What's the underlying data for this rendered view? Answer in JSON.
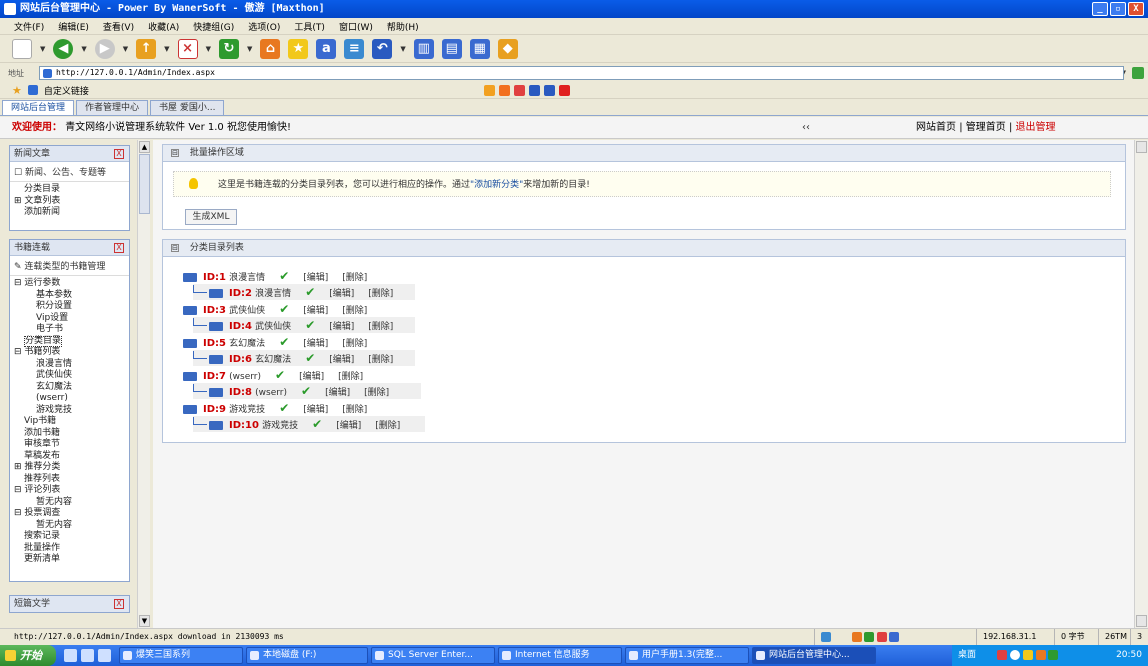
{
  "window": {
    "title": "网站后台管理中心 - Power By WanerSoft - 傲游 [Maxthon]",
    "min": "_",
    "max": "▫",
    "close": "X"
  },
  "menu": [
    "文件(F)",
    "编辑(E)",
    "查看(V)",
    "收藏(A)",
    "快捷组(G)",
    "选项(O)",
    "工具(T)",
    "窗口(W)",
    "帮助(H)"
  ],
  "address": {
    "label": "地址",
    "url": "http://127.0.0.1/Admin/Index.aspx"
  },
  "favbar": {
    "label": "自定义链接"
  },
  "tabs": [
    "网站后台管理",
    "作者管理中心",
    "书屋 爱国小..."
  ],
  "infobar": {
    "welcome": "欢迎使用：",
    "product": "青文网络小说管理系统软件  Ver 1.0   祝您使用愉快!",
    "arrows": "‹‹",
    "link_home": "网站首页",
    "sep": "|",
    "link_admin": "管理首页",
    "link_exit": "退出管理"
  },
  "sidebar": {
    "news": {
      "title": "新闻文章",
      "close": "X",
      "subtitle": "新闻、公告、专题等",
      "items": [
        "分类目录",
        "文章列表",
        "添加新闻"
      ]
    },
    "books": {
      "title": "书籍连载",
      "close": "X",
      "subtitle": "连载类型的书籍管理",
      "items": [
        "运行参数",
        "基本参数",
        "积分设置",
        "Vip设置",
        "电子书",
        "分类目录",
        "书籍列表",
        "浪漫言情",
        "武侠仙侠",
        "玄幻魔法",
        "(wserr)",
        "游戏竞技",
        "Vip书籍",
        "添加书籍",
        "审核章节",
        "草稿发布",
        "推荐分类",
        "推荐列表",
        "评论列表",
        "暂无内容",
        "投票调查",
        "暂无内容",
        "搜索记录",
        "批量操作",
        "更新清单"
      ]
    },
    "short": {
      "title": "短篇文学",
      "close": "X"
    }
  },
  "batch": {
    "title": "批量操作区域",
    "toggle": "⊟",
    "tip_before": "这里是书籍连载的分类目录列表，您可以进行相应的操作。通过",
    "tip_link": "\"添加新分类\"",
    "tip_after": "来增加新的目录!",
    "button": "生成XML"
  },
  "catalog": {
    "title": "分类目录列表",
    "toggle": "⊟",
    "check": "✔",
    "edit": "[编辑]",
    "delete": "[删除]",
    "rows": [
      {
        "id": "ID:1",
        "name": "浪漫言情"
      },
      {
        "id": "ID:2",
        "name": "浪漫言情"
      },
      {
        "id": "ID:3",
        "name": "武侠仙侠"
      },
      {
        "id": "ID:4",
        "name": "武侠仙侠"
      },
      {
        "id": "ID:5",
        "name": "玄幻魔法"
      },
      {
        "id": "ID:6",
        "name": "玄幻魔法"
      },
      {
        "id": "ID:7",
        "name": "(wserr)"
      },
      {
        "id": "ID:8",
        "name": "(wserr)"
      },
      {
        "id": "ID:9",
        "name": "游戏竞技"
      },
      {
        "id": "ID:10",
        "name": "游戏竞技"
      }
    ]
  },
  "statusbar": {
    "text": "http://127.0.0.1/Admin/Index.aspx download in 2130093 ms",
    "ip": "192.168.31.1",
    "bytes": "0 字节",
    "mem": "26TM",
    "count": "3"
  },
  "taskbar": {
    "start": "开始",
    "tasks": [
      "爆笑三国系列",
      "本地磁盘 (F:)",
      "SQL Server Enter...",
      "Internet 信息服务",
      "用户手册1.3(完整...",
      "网站后台管理中心..."
    ],
    "tray_label": "桌面",
    "clock": "20:50"
  }
}
